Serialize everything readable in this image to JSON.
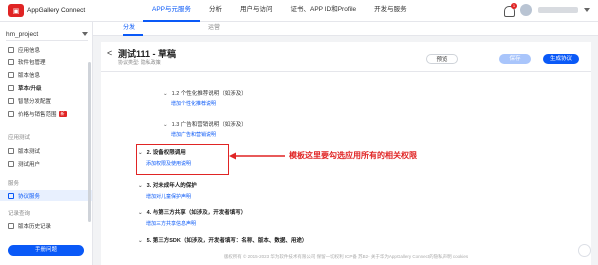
{
  "header": {
    "brand": "AppGallery Connect",
    "nav": [
      "APP与元服务",
      "分析",
      "用户与访问",
      "证书、APP ID和Profile",
      "开发与服务"
    ],
    "notification_count": "1"
  },
  "subnav": {
    "tabs": [
      "分发",
      "运营"
    ]
  },
  "sidebar": {
    "project": "hm_project",
    "items": [
      {
        "label": "应用信息"
      },
      {
        "label": "软件包管理"
      },
      {
        "label": "版本信息"
      },
      {
        "label": "草本/升级"
      },
      {
        "label": "智慧分发配置"
      },
      {
        "label": "价格与销售范围"
      }
    ],
    "hot_badge": "新",
    "groups": [
      "应用测试",
      "服务",
      "记录查询"
    ],
    "test_items": [
      {
        "label": "版本测试"
      },
      {
        "label": "测试用户"
      }
    ],
    "service_items": [
      {
        "label": "协议服务"
      }
    ],
    "record_items": [
      {
        "label": "版本历史记录"
      }
    ],
    "manual_button": "手册问题"
  },
  "main": {
    "back": "<",
    "title": "测试111 - 草稿",
    "subtitle": "协议类型:  隐私政策",
    "preview": "预览",
    "save": "保存",
    "submit": "生成协议",
    "sections": [
      {
        "heading": "1.2 个性化推荐说明（如涉及）",
        "link": "增加个性化推荐说明"
      },
      {
        "heading": "1.3 广告和营销说明（如涉及）",
        "link": "增加广告和营销说明"
      },
      {
        "heading": "2. 设备权限调用",
        "link": "添加权限及使用说明"
      },
      {
        "heading": "3. 对未成年人的保护",
        "link": "增加对儿童保护声明"
      },
      {
        "heading": "4. 与第三方共享（如涉及，开发者填写）",
        "link": "增加三方共享信息声明"
      },
      {
        "heading": "5. 第三方SDK（如涉及，开发者填写：名称、版本、数据、用途）",
        "link": ""
      }
    ],
    "annotation": "模板这里要勾选应用所有的相关权限",
    "footer": "版权所有 © 2015-2023 华为软件技术有限公司 保留一切权利    ICP备   苏B2-   关于华为AppGallery Connect的隐私声明    cookies"
  }
}
